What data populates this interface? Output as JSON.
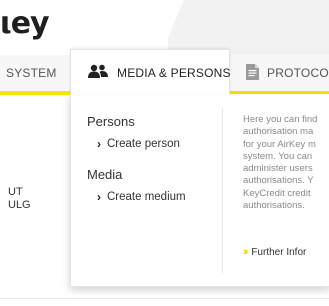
{
  "header": {
    "logo_fragment": "ιey"
  },
  "tabs": {
    "system": "SYSTEM",
    "media_persons": "MEDIA & PERSONS",
    "protocol": "PROTOCO"
  },
  "background_left": {
    "line1": "UT",
    "line2": "ULG"
  },
  "dropdown": {
    "persons_heading": "Persons",
    "create_person": "Create person",
    "media_heading": "Media",
    "create_medium": "Create medium",
    "info_lines": [
      "Here you can find",
      "authorisation ma",
      "for your AirKey m",
      "system. You can",
      "administer users",
      "authorisations. Y",
      "KeyCredit credit",
      "authorisations."
    ],
    "further_info": "Further Infor"
  },
  "colors": {
    "accent": "#f4e600"
  },
  "icons": {
    "persons": "users-icon",
    "protocol": "document-icon"
  }
}
